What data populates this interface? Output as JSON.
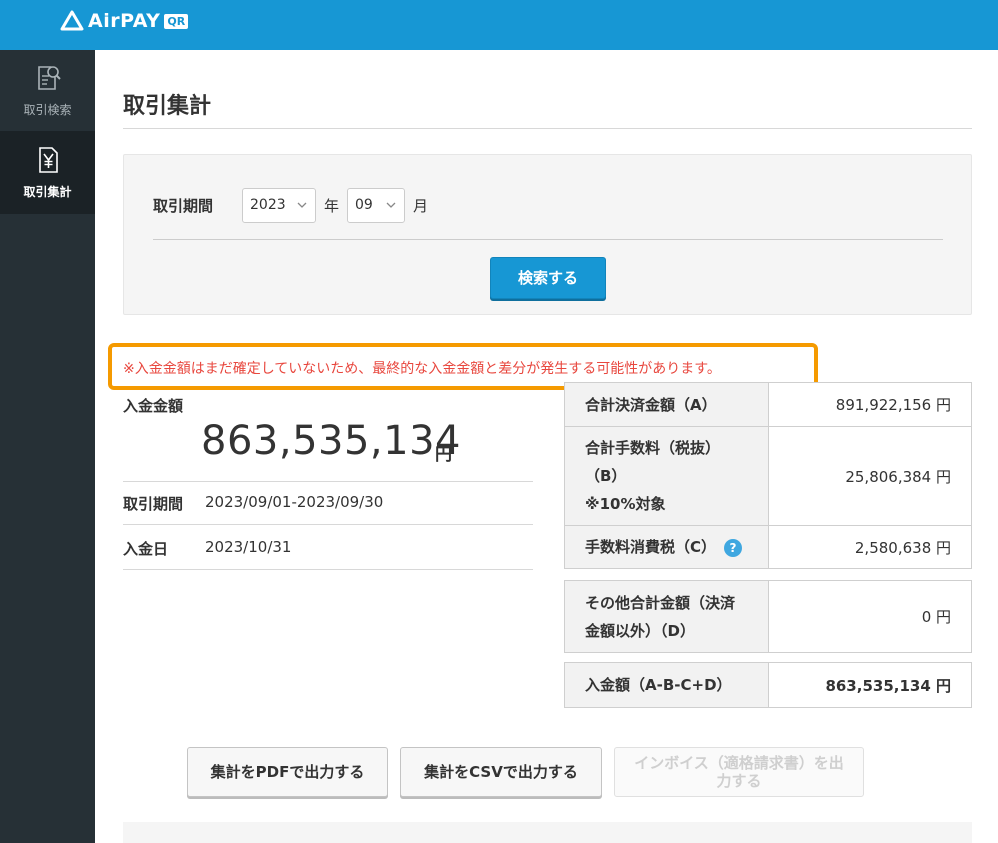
{
  "app": {
    "logo_text": "AirPAY",
    "logo_badge": "QR",
    "brand_color": "#1797d4"
  },
  "sidebar": {
    "items": [
      {
        "label": "取引検索",
        "icon": "document-search-icon",
        "active": false
      },
      {
        "label": "取引集計",
        "icon": "yen-document-icon",
        "active": true
      }
    ]
  },
  "page": {
    "title": "取引集計"
  },
  "search": {
    "period_label": "取引期間",
    "year_value": "2023",
    "year_unit": "年",
    "month_value": "09",
    "month_unit": "月",
    "button_label": "検索する"
  },
  "notice": {
    "text": "※入金金額はまだ確定していないため、最終的な入金金額と差分が発生する可能性があります。",
    "text_color": "#e8473e",
    "border_color": "#f59a00"
  },
  "summary": {
    "amount_label": "入金金額",
    "amount_value": "863,535,134",
    "amount_unit": "円",
    "period_label": "取引期間",
    "period_value": "2023/09/01-2023/09/30",
    "deposit_date_label": "入金日",
    "deposit_date_value": "2023/10/31"
  },
  "table": {
    "rows": [
      {
        "label": "合計決済金額（A）",
        "value": "891,922,156 円"
      },
      {
        "label": "合計手数料（税抜）（B）",
        "note": "※10%対象",
        "value": "25,806,384 円"
      },
      {
        "label": "手数料消費税（C）",
        "help": "?",
        "value": "2,580,638 円"
      },
      {
        "label": "その他合計金額（決済金額以外）（D）",
        "value": "0 円"
      },
      {
        "label": "入金額（A-B-C+D）",
        "value": "863,535,134 円"
      }
    ]
  },
  "actions": {
    "pdf_label": "集計をPDFで出力する",
    "csv_label": "集計をCSVで出力する",
    "invoice_label": "インボイス（適格請求書）を出力する"
  }
}
